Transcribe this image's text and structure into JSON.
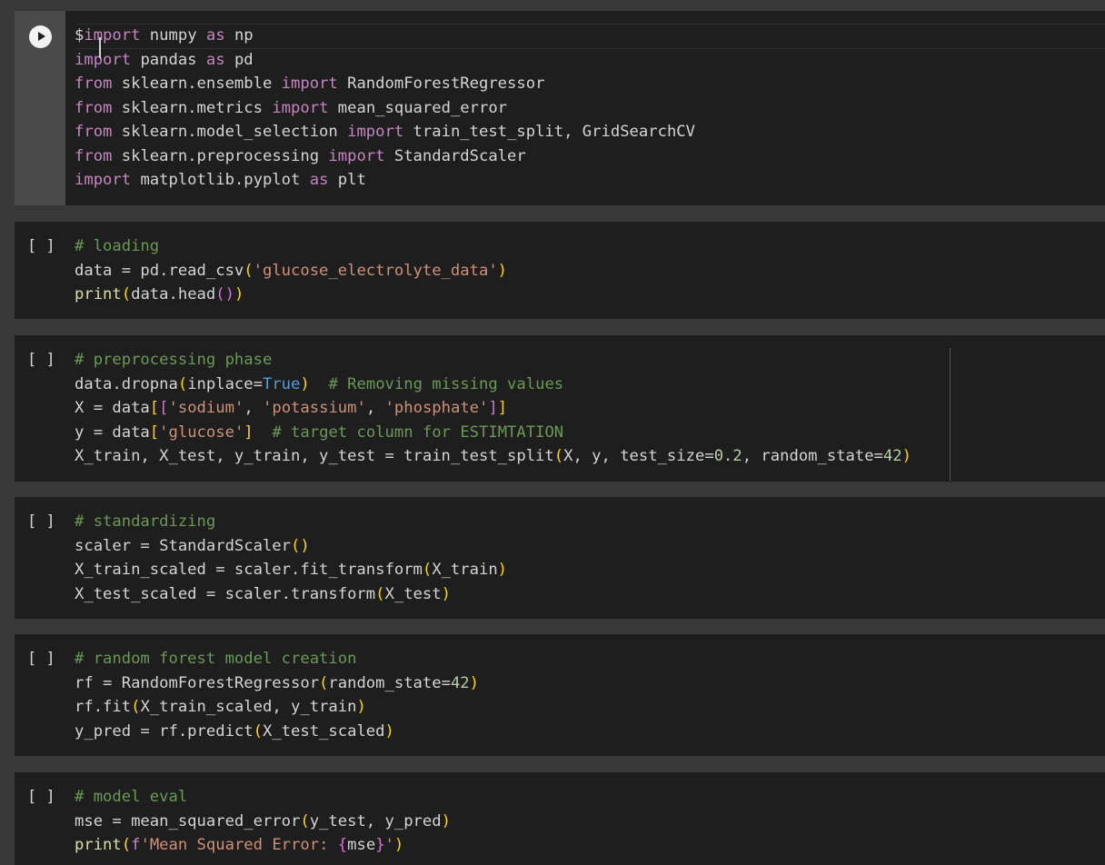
{
  "cells": [
    {
      "active": true,
      "exec": "",
      "lines": [
        [
          [
            "id",
            "$"
          ],
          [
            "kw",
            "import"
          ],
          [
            "id",
            " numpy "
          ],
          [
            "kw",
            "as"
          ],
          [
            "id",
            " np"
          ]
        ],
        [
          [
            "kw",
            "import"
          ],
          [
            "id",
            " pandas "
          ],
          [
            "kw",
            "as"
          ],
          [
            "id",
            " pd"
          ]
        ],
        [
          [
            "kw",
            "from"
          ],
          [
            "id",
            " sklearn.ensemble "
          ],
          [
            "kw",
            "import"
          ],
          [
            "id",
            " RandomForestRegressor"
          ]
        ],
        [
          [
            "kw",
            "from"
          ],
          [
            "id",
            " sklearn.metrics "
          ],
          [
            "kw",
            "import"
          ],
          [
            "id",
            " mean_squared_error"
          ]
        ],
        [
          [
            "kw",
            "from"
          ],
          [
            "id",
            " sklearn.model_selection "
          ],
          [
            "kw",
            "import"
          ],
          [
            "id",
            " train_test_split, GridSearchCV"
          ]
        ],
        [
          [
            "kw",
            "from"
          ],
          [
            "id",
            " sklearn.preprocessing "
          ],
          [
            "kw",
            "import"
          ],
          [
            "id",
            " StandardScaler"
          ]
        ],
        [
          [
            "kw",
            "import"
          ],
          [
            "id",
            " matplotlib.pyplot "
          ],
          [
            "kw",
            "as"
          ],
          [
            "id",
            " plt"
          ]
        ]
      ]
    },
    {
      "active": false,
      "exec": "[ ]",
      "lines": [
        [
          [
            "com",
            "# loading"
          ]
        ],
        [
          [
            "id",
            "data = pd.read_csv"
          ],
          [
            "br1",
            "("
          ],
          [
            "str",
            "'glucose_electrolyte_data'"
          ],
          [
            "br1",
            ")"
          ]
        ],
        [
          [
            "bi",
            "print"
          ],
          [
            "br1",
            "("
          ],
          [
            "id",
            "data.head"
          ],
          [
            "br2",
            "()"
          ],
          [
            "br1",
            ")"
          ]
        ]
      ]
    },
    {
      "active": false,
      "exec": "[ ]",
      "ruler": true,
      "lines": [
        [
          [
            "com",
            "# preprocessing phase"
          ]
        ],
        [
          [
            "id",
            "data.dropna"
          ],
          [
            "br1",
            "("
          ],
          [
            "id",
            "inplace="
          ],
          [
            "const",
            "True"
          ],
          [
            "br1",
            ")"
          ],
          [
            "id",
            "  "
          ],
          [
            "com",
            "# Removing missing values"
          ]
        ],
        [
          [
            "id",
            "X = data"
          ],
          [
            "br1",
            "["
          ],
          [
            "br2",
            "["
          ],
          [
            "str",
            "'sodium'"
          ],
          [
            "id",
            ", "
          ],
          [
            "str",
            "'potassium'"
          ],
          [
            "id",
            ", "
          ],
          [
            "str",
            "'phosphate'"
          ],
          [
            "br2",
            "]"
          ],
          [
            "br1",
            "]"
          ]
        ],
        [
          [
            "id",
            "y = data"
          ],
          [
            "br1",
            "["
          ],
          [
            "str",
            "'glucose'"
          ],
          [
            "br1",
            "]"
          ],
          [
            "id",
            "  "
          ],
          [
            "com",
            "# target column for ESTIMTATION"
          ]
        ],
        [
          [
            "id",
            "X_train, X_test, y_train, y_test = train_test_split"
          ],
          [
            "br1",
            "("
          ],
          [
            "id",
            "X, y, test_size="
          ],
          [
            "num",
            "0.2"
          ],
          [
            "id",
            ", random_state="
          ],
          [
            "num",
            "42"
          ],
          [
            "br1",
            ")"
          ]
        ]
      ]
    },
    {
      "active": false,
      "exec": "[ ]",
      "lines": [
        [
          [
            "com",
            "# standardizing"
          ]
        ],
        [
          [
            "id",
            "scaler = StandardScaler"
          ],
          [
            "br1",
            "()"
          ]
        ],
        [
          [
            "id",
            "X_train_scaled = scaler.fit_transform"
          ],
          [
            "br1",
            "("
          ],
          [
            "id",
            "X_train"
          ],
          [
            "br1",
            ")"
          ]
        ],
        [
          [
            "id",
            "X_test_scaled = scaler.transform"
          ],
          [
            "br1",
            "("
          ],
          [
            "id",
            "X_test"
          ],
          [
            "br1",
            ")"
          ]
        ]
      ]
    },
    {
      "active": false,
      "exec": "[ ]",
      "lines": [
        [
          [
            "com",
            "# random forest model creation"
          ]
        ],
        [
          [
            "id",
            "rf = RandomForestRegressor"
          ],
          [
            "br1",
            "("
          ],
          [
            "id",
            "random_state="
          ],
          [
            "num",
            "42"
          ],
          [
            "br1",
            ")"
          ]
        ],
        [
          [
            "id",
            "rf.fit"
          ],
          [
            "br1",
            "("
          ],
          [
            "id",
            "X_train_scaled, y_train"
          ],
          [
            "br1",
            ")"
          ]
        ],
        [
          [
            "id",
            "y_pred = rf.predict"
          ],
          [
            "br1",
            "("
          ],
          [
            "id",
            "X_test_scaled"
          ],
          [
            "br1",
            ")"
          ]
        ]
      ]
    },
    {
      "active": false,
      "exec": "[ ]",
      "lines": [
        [
          [
            "com",
            "# model eval"
          ]
        ],
        [
          [
            "id",
            "mse = mean_squared_error"
          ],
          [
            "br1",
            "("
          ],
          [
            "id",
            "y_test, y_pred"
          ],
          [
            "br1",
            ")"
          ]
        ],
        [
          [
            "bi",
            "print"
          ],
          [
            "br1",
            "("
          ],
          [
            "kw",
            "f"
          ],
          [
            "str",
            "'Mean Squared Error: "
          ],
          [
            "br2",
            "{"
          ],
          [
            "id",
            "mse"
          ],
          [
            "br2",
            "}"
          ],
          [
            "str",
            "'"
          ],
          [
            "br1",
            ")"
          ]
        ]
      ]
    }
  ],
  "colors": {
    "background": "#383838",
    "cell_background": "#1e1e1e",
    "keyword": "#c586c0",
    "string": "#ce9178",
    "comment": "#6a9955",
    "number": "#b5cea8",
    "builtin": "#dcdcaa",
    "constant": "#569cd6",
    "bracket_level1": "#ffd700",
    "bracket_level2": "#da70d6"
  },
  "icons": {
    "run": "play-circle-icon"
  }
}
